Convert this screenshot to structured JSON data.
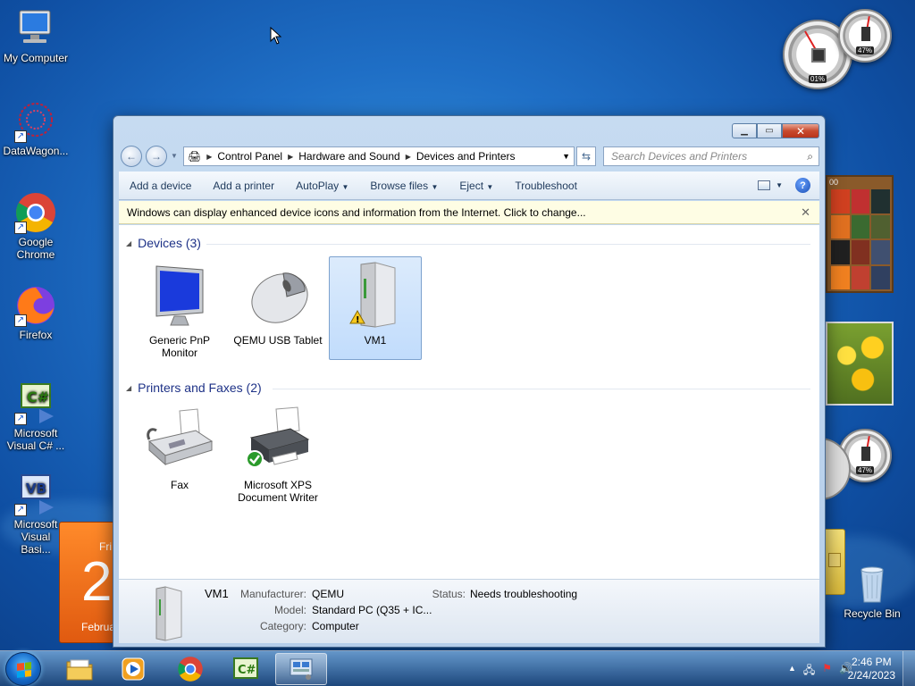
{
  "desktop": {
    "icons": [
      {
        "label": "My Computer"
      },
      {
        "label": "DataWagon..."
      },
      {
        "label": "Google Chrome"
      },
      {
        "label": "Firefox"
      },
      {
        "label": "Microsoft Visual C# ..."
      },
      {
        "label": "Microsoft Visual Basi..."
      },
      {
        "label": "Recycle Bin"
      }
    ],
    "gadgets": {
      "cpu_percent": "01%",
      "mem_percent": "47%",
      "mem_percent_2": "47%",
      "calendar_day_name": "Fri",
      "calendar_day": "2",
      "calendar_month": "Februa",
      "puzzle_counter": "00"
    }
  },
  "window": {
    "address": {
      "crumbs": [
        "Control Panel",
        "Hardware and Sound",
        "Devices and Printers"
      ]
    },
    "search_placeholder": "Search Devices and Printers",
    "toolbar": {
      "add_device": "Add a device",
      "add_printer": "Add a printer",
      "autoplay": "AutoPlay",
      "browse_files": "Browse files",
      "eject": "Eject",
      "troubleshoot": "Troubleshoot"
    },
    "infobar": "Windows can display enhanced device icons and information from the Internet. Click to change...",
    "groups": {
      "devices": "Devices (3)",
      "printers": "Printers and Faxes (2)"
    },
    "devices": [
      {
        "label": "Generic PnP Monitor"
      },
      {
        "label": "QEMU USB Tablet"
      },
      {
        "label": "VM1"
      }
    ],
    "printers": [
      {
        "label": "Fax"
      },
      {
        "label": "Microsoft XPS Document Writer"
      }
    ],
    "details": {
      "name": "VM1",
      "manufacturer_label": "Manufacturer:",
      "manufacturer": "QEMU",
      "model_label": "Model:",
      "model": "Standard PC (Q35 + IC...",
      "category_label": "Category:",
      "category": "Computer",
      "status_label": "Status:",
      "status": "Needs troubleshooting"
    }
  },
  "taskbar": {
    "time": "2:46 PM",
    "date": "2/24/2023"
  }
}
